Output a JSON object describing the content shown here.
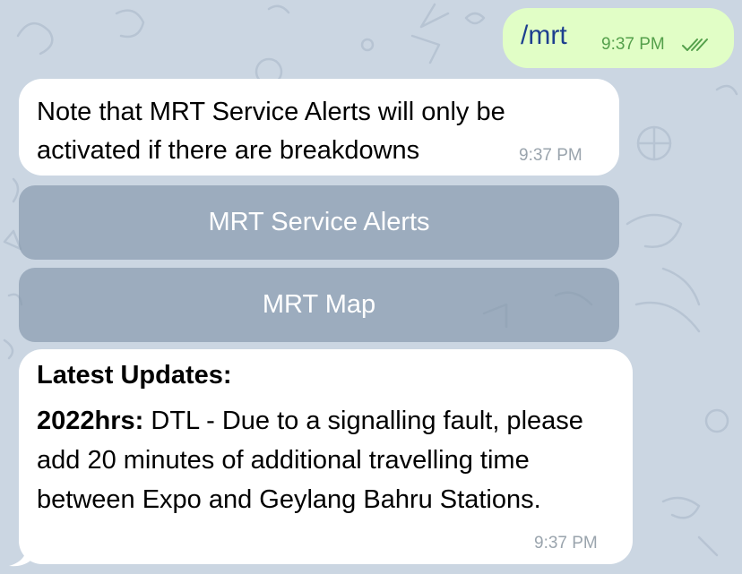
{
  "chat": {
    "outgoing": {
      "text": "/mrt",
      "time": "9:37 PM",
      "status_icon": "double-check-icon",
      "colors": {
        "bubble": "#e1fec6",
        "text": "#1d3f8f",
        "meta": "#54a04b"
      }
    },
    "note": {
      "text": "Note that MRT Service Alerts will only be\nactivated if there are breakdowns",
      "time": "9:37 PM"
    },
    "buttons": [
      {
        "label": "MRT Service Alerts"
      },
      {
        "label": "MRT Map"
      }
    ],
    "updates": {
      "title": "Latest Updates:",
      "time_label": "2022hrs:",
      "body": " DTL - Due to a signalling fault, please add 20 minutes of additional travelling time between Expo and Geylang Bahru Stations.",
      "time": "9:37 PM"
    }
  },
  "colors": {
    "background": "#cbd6e2",
    "incoming_bubble": "#ffffff",
    "inline_button": "#8093a8",
    "timestamp": "#9aa4ad"
  }
}
